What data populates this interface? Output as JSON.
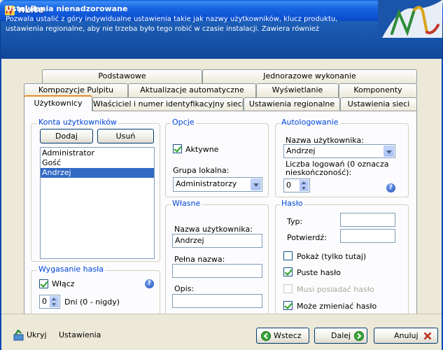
{
  "window": {
    "title": "nLite"
  },
  "header": {
    "title": "Ustawienia nienadzorowane",
    "description": "Pozwala ustalić z góry indywidualne ustawienia takie jak nazwy użytkowników, klucz produktu, ustawienia regionalne, aby nie trzeba było tego robić w czasie instalacji. Zawiera również"
  },
  "tabs": {
    "row1": [
      "Podstawowe",
      "Jednorazowe wykonanie"
    ],
    "row2": [
      "Kompozycje Pulpitu",
      "Aktualizacje automatyczne",
      "Wyświetlanie",
      "Komponenty"
    ],
    "row3": [
      "Użytkownicy",
      "Właściciel i numer identyfikacyjny sieci",
      "Ustawienia regionalne",
      "Ustawienia sieci"
    ]
  },
  "accounts": {
    "title": "Konta użytkowników",
    "add": "Dodaj",
    "remove": "Usuń",
    "users": [
      "Administrator",
      "Gość",
      "Andrzej"
    ],
    "selected": "Andrzej"
  },
  "password_expiry": {
    "title": "Wygasanie hasła",
    "enable": "Włącz",
    "days_value": "0",
    "days_label": "Dni (0 - nigdy)"
  },
  "options": {
    "title": "Opcje",
    "active": "Aktywne",
    "group_label": "Grupa lokalna:",
    "group_value": "Administratorzy"
  },
  "own": {
    "title": "Własne",
    "username_label": "Nazwa użytkownika:",
    "username_value": "Andrzej",
    "fullname_label": "Pełna nazwa:",
    "fullname_value": "",
    "desc_label": "Opis:",
    "desc_value": ""
  },
  "autologon": {
    "title": "Autologowanie",
    "username_label": "Nazwa użytkownika:",
    "username_value": "Andrzej",
    "count_label": "Liczba logowań (0 oznacza nieskończoność):",
    "count_value": "0"
  },
  "password": {
    "title": "Hasło",
    "type_label": "Typ:",
    "confirm_label": "Potwierdź:",
    "show": "Pokaż (tylko tutaj)",
    "empty": "Puste hasło",
    "must_have": "Musi posiadać hasło",
    "can_change": "Może zmieniać hasło"
  },
  "footer": {
    "hide": "Ukryj",
    "section": "Ustawienia",
    "back": "Wstecz",
    "next": "Dalej",
    "cancel": "Anuluj"
  }
}
